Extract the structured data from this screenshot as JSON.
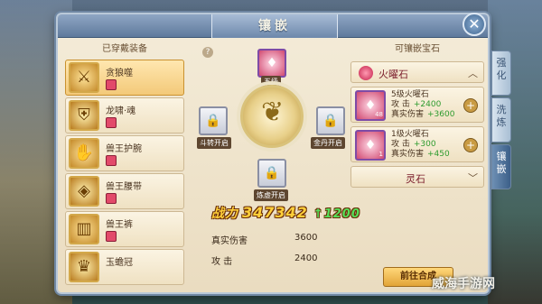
{
  "window": {
    "title": "镶嵌",
    "close_symbol": "✕"
  },
  "side_tabs": [
    {
      "label": "强化",
      "active": false
    },
    {
      "label": "洗炼",
      "active": false
    },
    {
      "label": "镶嵌",
      "active": true
    }
  ],
  "equipped": {
    "header": "已穿戴装备",
    "items": [
      {
        "name": "贪狼噬",
        "icon": "spear-icon",
        "selected": true
      },
      {
        "name": "龙啸·魂",
        "icon": "armor-icon",
        "selected": false
      },
      {
        "name": "兽王护腕",
        "icon": "bracer-icon",
        "selected": false
      },
      {
        "name": "兽王腰带",
        "icon": "belt-icon",
        "selected": false
      },
      {
        "name": "兽王裤",
        "icon": "pants-icon",
        "selected": false
      },
      {
        "name": "玉蟾冠",
        "icon": "crown-icon",
        "selected": false
      }
    ]
  },
  "socket": {
    "help_symbol": "?",
    "slots": [
      {
        "label": "五级",
        "type": "gem"
      },
      {
        "label": "斗转开启",
        "type": "locked"
      },
      {
        "label": "金丹开启",
        "type": "locked"
      },
      {
        "label": "炼虚开启",
        "type": "locked"
      }
    ]
  },
  "power": {
    "label": "战力",
    "value": "347342",
    "increase": "↑1200"
  },
  "stats": [
    {
      "name": "真实伤害",
      "value": "3600"
    },
    {
      "name": "攻    击",
      "value": "2400"
    }
  ],
  "gems": {
    "header": "可镶嵌宝石",
    "categories": [
      {
        "name": "火曜石",
        "expanded": true
      },
      {
        "name": "灵石",
        "expanded": false
      }
    ],
    "items": [
      {
        "name": "5级火曜石",
        "count": "48",
        "stats": [
          {
            "name": "攻    击",
            "value": "+2400"
          },
          {
            "name": "真实伤害",
            "value": "+3600"
          }
        ]
      },
      {
        "name": "1级火曜石",
        "count": "1",
        "stats": [
          {
            "name": "攻    击",
            "value": "+300"
          },
          {
            "name": "真实伤害",
            "value": "+450"
          }
        ]
      }
    ],
    "go_button": "前往合成"
  },
  "watermark": "威海手游网"
}
